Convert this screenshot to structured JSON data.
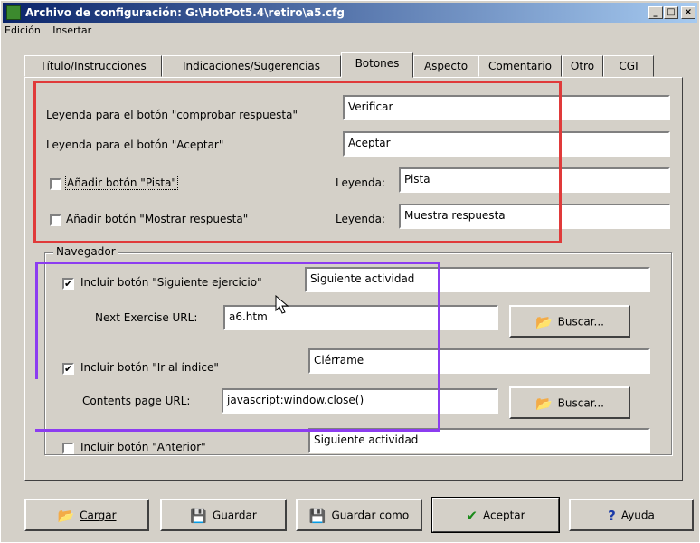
{
  "window": {
    "title": "Archivo de configuración: G:\\HotPot5.4\\retiro\\a5.cfg",
    "controls": {
      "minimize": "_",
      "maximize": "□",
      "close": "×"
    }
  },
  "menu": [
    "Edición",
    "Insertar"
  ],
  "tabs": [
    "Título/Instrucciones",
    "Indicaciones/Sugerencias",
    "Botones",
    "Aspecto",
    "Comentario",
    "Otro",
    "CGI"
  ],
  "active_tab": "Botones",
  "buttons_section": {
    "check_label": "Leyenda para el botón \"comprobar respuesta\"",
    "check_value": "Verificar",
    "accept_label": "Leyenda para el botón \"Aceptar\"",
    "accept_value": "Aceptar",
    "hint_checkbox": "Añadir botón \"Pista\"",
    "hint_checked": false,
    "hint_legend_label": "Leyenda:",
    "hint_value": "Pista",
    "show_checkbox": "Añadir botón \"Mostrar respuesta\"",
    "show_checked": false,
    "show_legend_label": "Leyenda:",
    "show_value": "Muestra respuesta"
  },
  "navigator": {
    "group_title": "Navegador",
    "next_checkbox": "Incluir botón \"Siguiente ejercicio\"",
    "next_checked": true,
    "next_value": "Siguiente actividad",
    "next_url_label": "Next Exercise URL:",
    "next_url_value": "a6.htm",
    "browse1": "Buscar...",
    "index_checkbox": "Incluir botón \"Ir al índice\"",
    "index_checked": true,
    "index_value": "Ciérrame",
    "contents_url_label": "Contents page URL:",
    "contents_url_value": "javascript:window.close()",
    "browse2": "Buscar...",
    "prev_checkbox": "Incluir botón \"Anterior\"",
    "prev_checked": false,
    "prev_value": "Siguiente actividad"
  },
  "footer": {
    "load": "Cargar",
    "save": "Guardar",
    "save_as": "Guardar como",
    "ok": "Aceptar",
    "help": "Ayuda"
  }
}
